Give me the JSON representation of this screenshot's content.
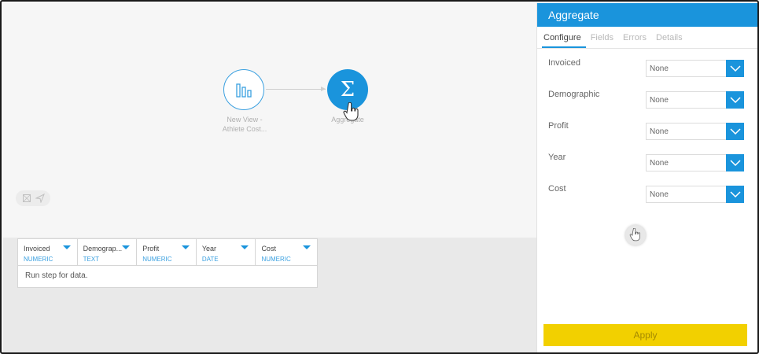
{
  "canvas": {
    "nodes": [
      {
        "label_line1": "New View -",
        "label_line2": "Athlete Cost...",
        "icon": "bar-chart-icon"
      },
      {
        "label": "Aggregate",
        "icon": "sigma-icon",
        "symbol": "Σ"
      }
    ]
  },
  "grid": {
    "columns": [
      {
        "name": "Invoiced",
        "type": "NUMERIC"
      },
      {
        "name": "Demograp...",
        "type": "TEXT"
      },
      {
        "name": "Profit",
        "type": "NUMERIC"
      },
      {
        "name": "Year",
        "type": "DATE"
      },
      {
        "name": "Cost",
        "type": "NUMERIC"
      }
    ],
    "empty_message": "Run step for data."
  },
  "panel": {
    "title": "Aggregate",
    "tabs": [
      "Configure",
      "Fields",
      "Errors",
      "Details"
    ],
    "active_tab": "Configure",
    "fields": [
      {
        "label": "Invoiced",
        "value": "None"
      },
      {
        "label": "Demographic",
        "value": "None"
      },
      {
        "label": "Profit",
        "value": "None"
      },
      {
        "label": "Year",
        "value": "None"
      },
      {
        "label": "Cost",
        "value": "None"
      }
    ],
    "apply_label": "Apply"
  },
  "colors": {
    "accent": "#1a94dc",
    "apply_button": "#f2d000",
    "type_text": "#3aa0e0"
  }
}
